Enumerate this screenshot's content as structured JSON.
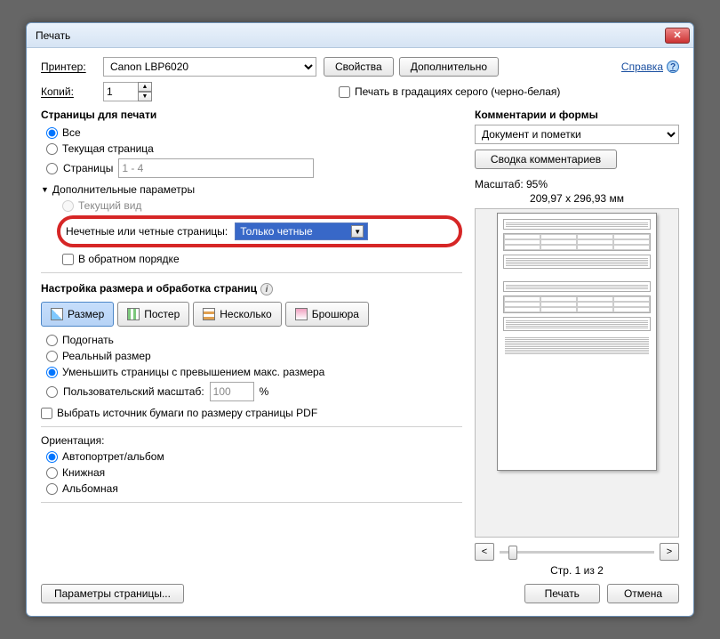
{
  "title": "Печать",
  "close_glyph": "✕",
  "help": {
    "label": "Справка",
    "glyph": "?"
  },
  "printer": {
    "label": "Принтер:",
    "value": "Canon LBP6020",
    "properties": "Свойства",
    "advanced": "Дополнительно"
  },
  "copies": {
    "label": "Копий:",
    "value": "1"
  },
  "grayscale": {
    "label": "Печать в градациях серого (черно-белая)",
    "checked": false
  },
  "pages": {
    "title": "Страницы для печати",
    "all": "Все",
    "current": "Текущая страница",
    "range_label": "Страницы",
    "range_value": "1 - 4",
    "more_params": "Дополнительные параметры",
    "current_view": "Текущий вид",
    "odd_even_label": "Нечетные или четные страницы:",
    "odd_even_value": "Только четные",
    "reverse": "В обратном порядке"
  },
  "sizing": {
    "title": "Настройка размера и обработка страниц",
    "size": "Размер",
    "poster": "Постер",
    "multiple": "Несколько",
    "booklet": "Брошюра",
    "fit": "Подогнать",
    "actual": "Реальный размер",
    "shrink": "Уменьшить страницы с превышением макс. размера",
    "custom": "Пользовательский масштаб:",
    "custom_value": "100",
    "percent": "%",
    "paper_source": "Выбрать источник бумаги по размеру страницы PDF"
  },
  "orientation": {
    "title": "Ориентация:",
    "auto": "Автопортрет/альбом",
    "portrait": "Книжная",
    "landscape": "Альбомная"
  },
  "comments": {
    "title": "Комментарии и формы",
    "value": "Документ и пометки",
    "summary": "Сводка комментариев"
  },
  "preview": {
    "scale_label": "Масштаб: 95%",
    "dims": "209,97 x 296,93 мм",
    "page_of": "Стр. 1 из 2",
    "prev": "<",
    "next": ">"
  },
  "footer": {
    "page_setup": "Параметры страницы...",
    "print": "Печать",
    "cancel": "Отмена"
  }
}
